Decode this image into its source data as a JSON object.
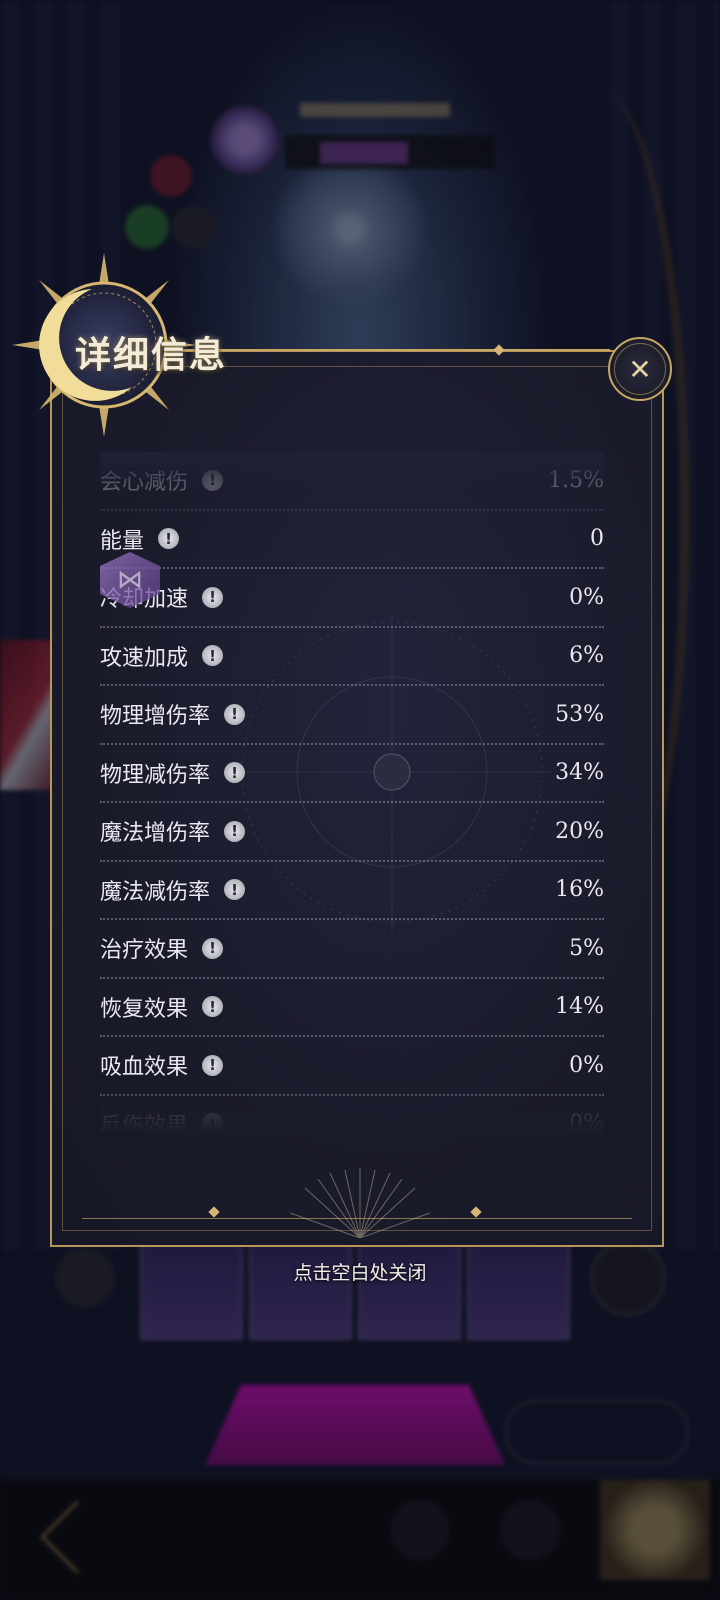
{
  "panel": {
    "title": "详细信息",
    "close_hint": "点击空白处关闭"
  },
  "stats": [
    {
      "label": "会心减伤",
      "value": "1.5%"
    },
    {
      "label": "能量",
      "value": "0"
    },
    {
      "label": "冷却加速",
      "value": "0%"
    },
    {
      "label": "攻速加成",
      "value": "6%"
    },
    {
      "label": "物理增伤率",
      "value": "53%"
    },
    {
      "label": "物理减伤率",
      "value": "34%"
    },
    {
      "label": "魔法增伤率",
      "value": "20%"
    },
    {
      "label": "魔法减伤率",
      "value": "16%"
    },
    {
      "label": "治疗效果",
      "value": "5%"
    },
    {
      "label": "恢复效果",
      "value": "14%"
    },
    {
      "label": "吸血效果",
      "value": "0%"
    },
    {
      "label": "反伤效果",
      "value": "0%"
    }
  ],
  "icons": {
    "info": "!",
    "close": "✕",
    "badge": "⋈"
  },
  "colors": {
    "accent_gold": "#c8a664",
    "panel_bg": "#1a1b2b",
    "cta_magenta": "#c214b6"
  }
}
